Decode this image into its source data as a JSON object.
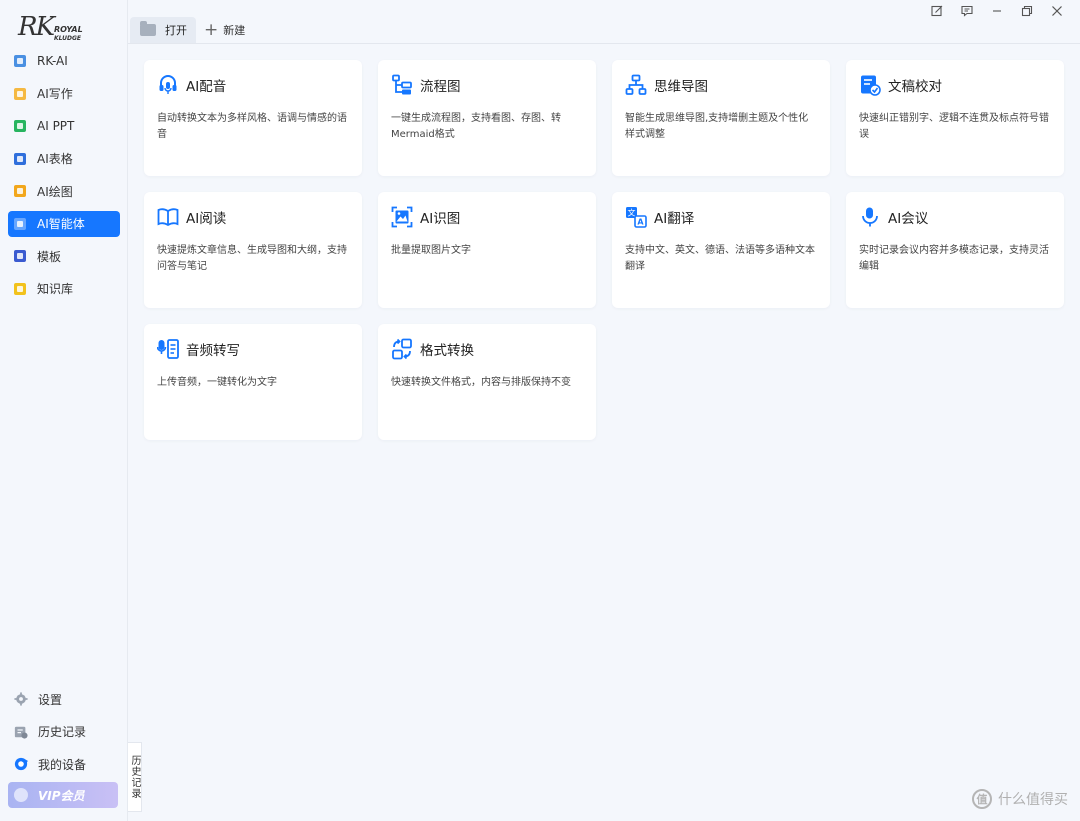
{
  "logo": {
    "main": "RK",
    "line1": "ROYAL",
    "line2": "KLUDGE"
  },
  "sidebar": {
    "items": [
      {
        "label": "RK-AI",
        "color": "#4a90e2"
      },
      {
        "label": "AI写作",
        "color": "#f5b942"
      },
      {
        "label": "AI PPT",
        "color": "#27b45f"
      },
      {
        "label": "AI表格",
        "color": "#2f6fdc"
      },
      {
        "label": "AI绘图",
        "color": "#f2a71c"
      },
      {
        "label": "AI智能体",
        "color": "#3ec47a",
        "active": true
      },
      {
        "label": "模板",
        "color": "#3b5bd0"
      },
      {
        "label": "知识库",
        "color": "#f2c21c"
      }
    ],
    "bottom": [
      {
        "label": "设置",
        "icon": "gear-icon"
      },
      {
        "label": "历史记录",
        "icon": "history-icon"
      },
      {
        "label": "我的设备",
        "icon": "device-icon"
      }
    ],
    "vip_label": "VIP会员",
    "history_tab": "历史记录"
  },
  "topbar": {
    "open_label": "打开",
    "new_label": "新建",
    "window_buttons": [
      "edit-icon",
      "feedback-icon",
      "minimize-icon",
      "restore-icon",
      "close-icon"
    ]
  },
  "cards": [
    {
      "title": "AI配音",
      "desc": "自动转换文本为多样风格、语调与情感的语音",
      "icon": "voice-icon"
    },
    {
      "title": "流程图",
      "desc": "一键生成流程图，支持看图、存图、转Mermaid格式",
      "icon": "flowchart-icon"
    },
    {
      "title": "思维导图",
      "desc": "智能生成思维导图,支持增删主题及个性化样式调整",
      "icon": "mindmap-icon"
    },
    {
      "title": "文稿校对",
      "desc": "快速纠正错别字、逻辑不连贯及标点符号错误",
      "icon": "proofread-icon"
    },
    {
      "title": "AI阅读",
      "desc": "快速提炼文章信息、生成导图和大纲，支持问答与笔记",
      "icon": "book-icon"
    },
    {
      "title": "AI识图",
      "desc": "批量提取图片文字",
      "icon": "image-recognition-icon"
    },
    {
      "title": "AI翻译",
      "desc": "支持中文、英文、德语、法语等多语种文本翻译",
      "icon": "translate-icon"
    },
    {
      "title": "AI会议",
      "desc": "实时记录会议内容并多模态记录，支持灵活编辑",
      "icon": "microphone-icon"
    },
    {
      "title": "音频转写",
      "desc": "上传音频，一键转化为文字",
      "icon": "audio-transcribe-icon"
    },
    {
      "title": "格式转换",
      "desc": "快速转换文件格式，内容与排版保持不变",
      "icon": "format-convert-icon"
    }
  ],
  "watermark": {
    "symbol": "值",
    "text": "什么值得买"
  },
  "accent": "#1677ff"
}
